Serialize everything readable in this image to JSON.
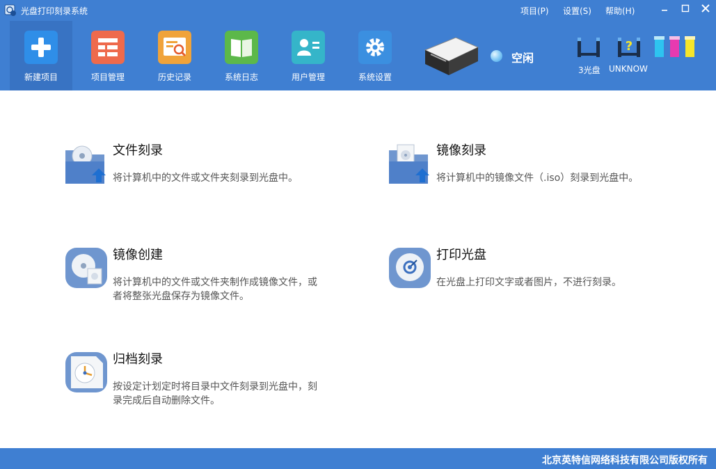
{
  "window": {
    "title": "光盘打印刻录系统",
    "menus": [
      "项目(P)",
      "设置(S)",
      "帮助(H)"
    ],
    "controls": {
      "minimize": "–",
      "maximize": "□",
      "close": "✕"
    }
  },
  "toolbar": {
    "items": [
      {
        "label": "新建项目",
        "icon": "plus-icon",
        "color": "#2f8ee8",
        "active": true
      },
      {
        "label": "项目管理",
        "icon": "list-icon",
        "color": "#ee6a4c"
      },
      {
        "label": "历史记录",
        "icon": "history-icon",
        "color": "#f0a33a"
      },
      {
        "label": "系统日志",
        "icon": "book-icon",
        "color": "#5cb84a"
      },
      {
        "label": "用户管理",
        "icon": "user-card-icon",
        "color": "#35b5c9"
      },
      {
        "label": "系统设置",
        "icon": "gear-icon",
        "color": "#3b8fe0"
      }
    ]
  },
  "device": {
    "icon": "disc-printer-icon",
    "status": "空闲",
    "drives": [
      {
        "label": "3光盘",
        "icon": "disc-tray-icon"
      },
      {
        "label": "UNKNOW",
        "icon": "unknown-tray-icon"
      }
    ],
    "inks": [
      "#2ec4f0",
      "#e83ab0",
      "#f5e52a"
    ]
  },
  "tasks": [
    {
      "title": "文件刻录",
      "desc": "将计算机中的文件或文件夹刻录到光盘中。",
      "icon": "folder-disc-icon"
    },
    {
      "title": "镜像刻录",
      "desc": "将计算机中的镜像文件（.iso）刻录到光盘中。",
      "icon": "folder-image-icon"
    },
    {
      "title": "镜像创建",
      "desc": "将计算机中的文件或文件夹制作成镜像文件，或者将整张光盘保存为镜像文件。",
      "icon": "image-create-icon"
    },
    {
      "title": "打印光盘",
      "desc": "在光盘上打印文字或者图片，不进行刻录。",
      "icon": "print-disc-icon"
    },
    {
      "title": "归档刻录",
      "desc": "按设定计划定时将目录中文件刻录到光盘中，刻录完成后自动删除文件。",
      "icon": "clock-archive-icon"
    }
  ],
  "footer": {
    "copyright": "北京英特信网络科技有限公司版权所有"
  }
}
